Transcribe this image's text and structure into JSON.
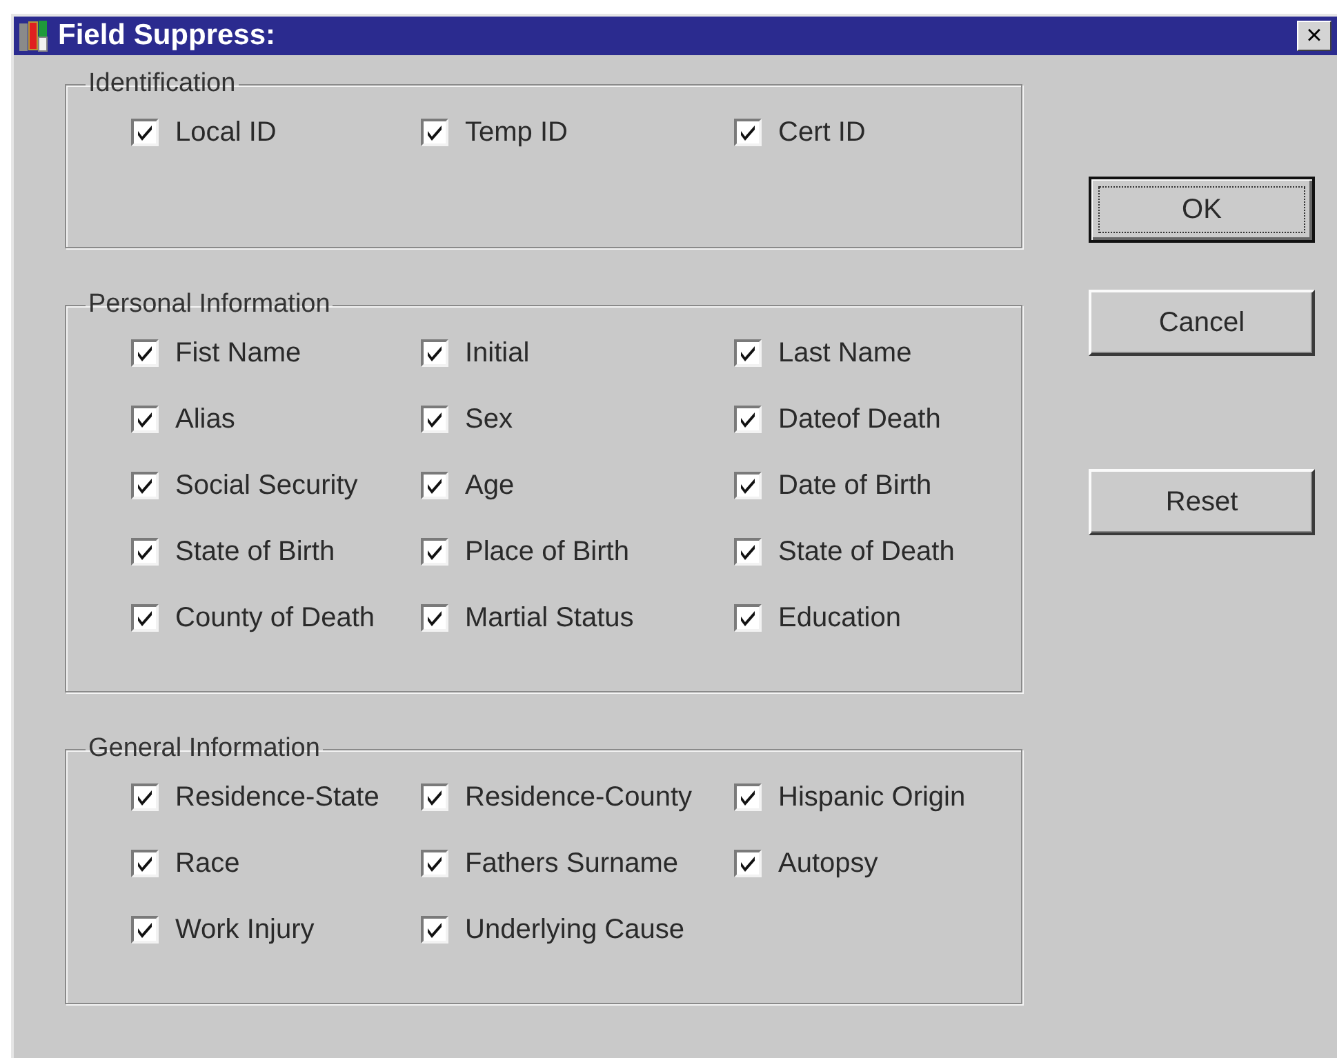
{
  "window": {
    "title": "Field Suppress:",
    "close": "×"
  },
  "groups": [
    {
      "title": "Identification",
      "items": [
        {
          "label": "Local ID",
          "checked": true
        },
        {
          "label": "Temp ID",
          "checked": true
        },
        {
          "label": "Cert ID",
          "checked": true
        }
      ]
    },
    {
      "title": "Personal Information",
      "items": [
        {
          "label": "Fist Name",
          "checked": true
        },
        {
          "label": "Initial",
          "checked": true
        },
        {
          "label": "Last Name",
          "checked": true
        },
        {
          "label": "Alias",
          "checked": true
        },
        {
          "label": "Sex",
          "checked": true
        },
        {
          "label": "Dateof Death",
          "checked": true
        },
        {
          "label": "Social Security",
          "checked": true
        },
        {
          "label": "Age",
          "checked": true
        },
        {
          "label": "Date of Birth",
          "checked": true
        },
        {
          "label": "State of Birth",
          "checked": true
        },
        {
          "label": "Place of Birth",
          "checked": true
        },
        {
          "label": "State of Death",
          "checked": true
        },
        {
          "label": "County of Death",
          "checked": true
        },
        {
          "label": "Martial Status",
          "checked": true
        },
        {
          "label": "Education",
          "checked": true
        }
      ]
    },
    {
      "title": "General Information",
      "items": [
        {
          "label": "Residence-State",
          "checked": true
        },
        {
          "label": "Residence-County",
          "checked": true
        },
        {
          "label": "Hispanic Origin",
          "checked": true
        },
        {
          "label": "Race",
          "checked": true
        },
        {
          "label": "Fathers Surname",
          "checked": true
        },
        {
          "label": "Autopsy",
          "checked": true
        },
        {
          "label": "Work Injury",
          "checked": true
        },
        {
          "label": "Underlying Cause",
          "checked": true
        }
      ]
    }
  ],
  "buttons": [
    {
      "label": "OK",
      "default": true
    },
    {
      "label": "Cancel",
      "default": false
    },
    {
      "label": "Reset",
      "default": false
    }
  ]
}
